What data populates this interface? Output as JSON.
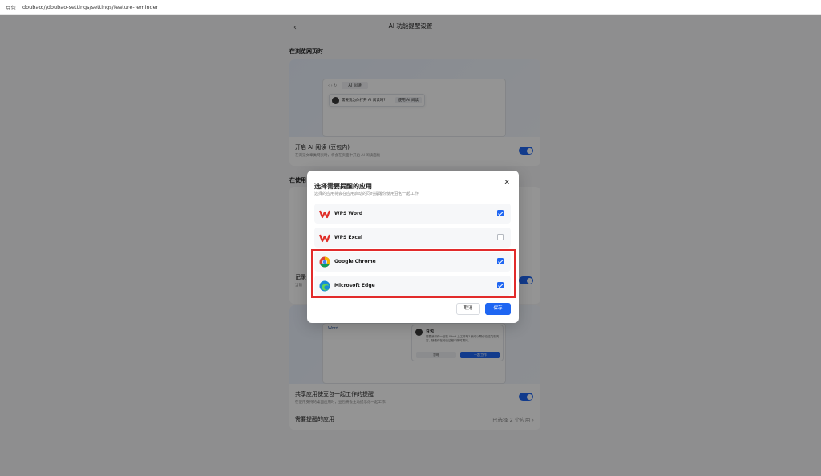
{
  "address_bar": {
    "app_name": "豆包",
    "url": "doubao://doubao-settings/settings/feature-reminder"
  },
  "page": {
    "title": "AI 功能提醒设置",
    "back_icon": "chevron-left-icon",
    "section1": {
      "label": "在浏览网页时",
      "illustration": {
        "tab_label": "AI 阅读",
        "prompt_text": "需要我为你打开 AI 阅读吗?",
        "prompt_button": "使用 AI 阅读"
      },
      "setting_title": "开启 AI 阅读 (豆包内)",
      "setting_desc": "在浏览文章类网页时，将会在页面中开启 AI 阅读面板",
      "toggle_on": true
    },
    "section2": {
      "label": "在使用",
      "mid_title": "记录",
      "mid_desc": "当前",
      "mid_toggle_on": true,
      "illustration": {
        "doc_label": "Word",
        "card_name": "豆包",
        "card_text": "需要我和你一起在 Word 上工作吗? 我可以帮你总结文档内容，随着你在阅读过程中随时提问。",
        "card_btn1": "忽略",
        "card_btn2": "一起工作"
      },
      "share_title": "共享应用使豆包一起工作的提醒",
      "share_desc": "在使用支持的桌面应用时，豆包将会主动提示你一起工作。",
      "share_toggle_on": true,
      "apps_row_label": "需要提醒的应用",
      "apps_row_value": "已选择 2 个应用"
    }
  },
  "modal": {
    "title": "选择需要提醒的应用",
    "subtitle": "选择的应用将会在应用启动的同时提醒你使用豆包一起工作",
    "close_icon": "close-icon",
    "apps": [
      {
        "name": "WPS Word",
        "icon": "wps-icon",
        "checked": true
      },
      {
        "name": "WPS Excel",
        "icon": "wps-icon",
        "checked": false
      },
      {
        "name": "Google Chrome",
        "icon": "chrome-icon",
        "checked": true
      },
      {
        "name": "Microsoft Edge",
        "icon": "edge-icon",
        "checked": true
      }
    ],
    "cancel_label": "取消",
    "save_label": "保存"
  },
  "colors": {
    "accent": "#1f66f2",
    "highlight": "#e22b2b",
    "wps_red": "#e0302a"
  }
}
